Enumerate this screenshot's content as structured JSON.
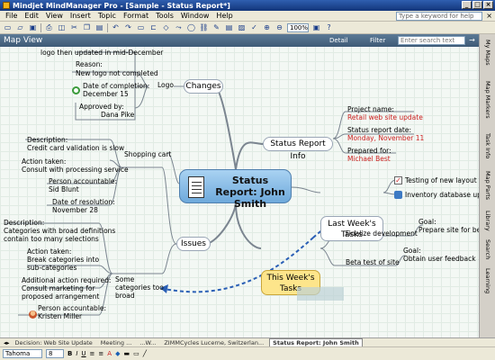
{
  "window": {
    "title": "Mindjet MindManager Pro - [Sample - Status Report*]",
    "controls": [
      "_",
      "□",
      "×"
    ]
  },
  "menu": {
    "items": [
      "File",
      "Edit",
      "View",
      "Insert",
      "Topic",
      "Format",
      "Tools",
      "Window",
      "Help"
    ],
    "help_placeholder": "Type a keyword for help"
  },
  "toolbar": {
    "zoom": "100%"
  },
  "map_view": {
    "title": "Map View",
    "detail_label": "Detail",
    "filter_label": "Filter",
    "search_placeholder": "Enter search text"
  },
  "central_topic": {
    "title": "Status Report: John Smith"
  },
  "topics": {
    "changes": {
      "label": "Changes"
    },
    "logo": {
      "label": "Logo",
      "top_note": "logo then updated in mid-December",
      "reason_label": "Reason:",
      "reason": "New logo not completed",
      "completion_label": "Date of completion:",
      "completion": "December 15",
      "approved_label": "Approved by:",
      "approved": "Dana Pike"
    },
    "status_info": {
      "label": "Status Report Info",
      "project_label": "Project name:",
      "project": "Retail web site update",
      "date_label": "Status report date:",
      "date": "Monday, November 11",
      "prepared_label": "Prepared for:",
      "prepared": "Michael Best"
    },
    "last_week": {
      "line1": "Last Week's",
      "line2": "Tasks",
      "task1": "Testing of new layout",
      "task2": "Inventory database upd"
    },
    "this_week": {
      "line1": "This Week's",
      "line2": "Tasks",
      "task1": "Finalize development",
      "goal1_label": "Goal:",
      "goal1": "Prepare site for be",
      "task2": "Beta test of site",
      "goal2_label": "Goal:",
      "goal2": "Obtain user feedback"
    },
    "issues": {
      "label": "Issues",
      "shopping_cart": "Shopping cart",
      "desc_label": "Description:",
      "desc": "Credit card validation is slow",
      "action_label": "Action taken:",
      "action": "Consult with processing service",
      "person_label": "Person accountable:",
      "person": "Sid Blunt",
      "resolution_label": "Date of resolution:",
      "resolution": "November 28",
      "broad": "Some categories too broad",
      "desc2_label": "Description:",
      "desc2_l1": "Categories with broad definitions",
      "desc2_l2": "contain too many selections",
      "action2_label": "Action taken:",
      "action2_l1": "Break categories into",
      "action2_l2": "sub-categories",
      "addl_label": "Additional action required:",
      "addl_l1": "Consult marketing for",
      "addl_l2": "proposed arrangement",
      "person2_label": "Person accountable:",
      "person2": "Kristen Miller"
    }
  },
  "right_panel": {
    "tabs": [
      "My Maps",
      "Map Markers",
      "Task Info",
      "Map Parts",
      "Library",
      "Search",
      "Learning"
    ]
  },
  "doc_tabs": {
    "items": [
      "Decision: Web Site Update",
      "Meeting ...",
      "...W...",
      "ZIMMCycles Lucerne, Switzerlan...",
      "Status Report: John Smith"
    ],
    "active_index": 4
  },
  "format_bar": {
    "font": "Tahoma",
    "size": "8"
  }
}
